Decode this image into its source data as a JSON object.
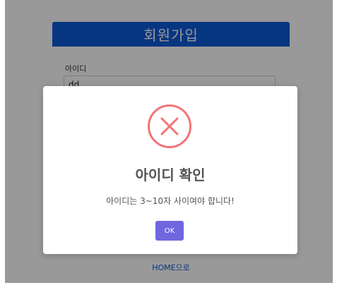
{
  "signup": {
    "title": "회원가입",
    "id_label": "아이디",
    "id_value": "dd",
    "home_link": "HOME으로"
  },
  "modal": {
    "icon": "error-x-circle-icon",
    "title": "아이디 확인",
    "message": "아이디는 3~10자 사이여야 합니다!",
    "ok_label": "OK"
  },
  "colors": {
    "header_blue": "#0d5ad8",
    "error_red": "#f27474",
    "ok_purple": "#7066e0",
    "overlay_gray": "#979797"
  }
}
